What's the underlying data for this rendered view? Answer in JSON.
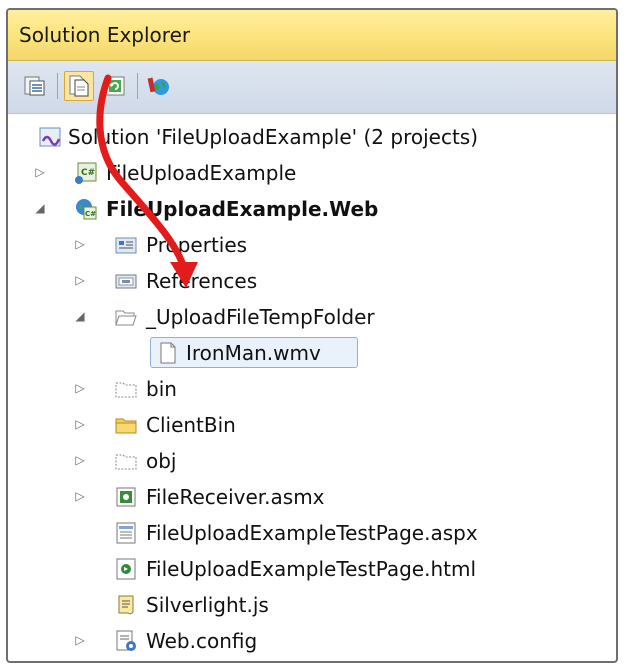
{
  "window": {
    "title": "Solution Explorer"
  },
  "toolbar": {
    "buttons": [
      {
        "icon": "properties-icon"
      },
      {
        "icon": "show-all-files-icon",
        "active": true
      },
      {
        "icon": "refresh-icon"
      },
      {
        "icon": "view-in-browser-icon"
      }
    ]
  },
  "tree": {
    "items": [
      {
        "label": "Solution 'FileUploadExample' (2 projects)",
        "icon": "solution-icon",
        "arrow": ""
      },
      {
        "label": "FileUploadExample",
        "icon": "csharp-project-icon",
        "arrow": "collapsed"
      },
      {
        "label": "FileUploadExample.Web",
        "icon": "web-project-icon",
        "arrow": "expanded",
        "bold": true
      },
      {
        "label": "Properties",
        "icon": "properties-folder-icon",
        "arrow": "collapsed"
      },
      {
        "label": "References",
        "icon": "references-icon",
        "arrow": "collapsed"
      },
      {
        "label": "_UploadFileTempFolder",
        "icon": "open-folder-icon",
        "arrow": "expanded"
      },
      {
        "label": "IronMan.wmv",
        "icon": "file-icon",
        "arrow": "",
        "selected": true
      },
      {
        "label": "bin",
        "icon": "folder-dotted-icon",
        "arrow": "collapsed"
      },
      {
        "label": "ClientBin",
        "icon": "folder-icon",
        "arrow": "collapsed"
      },
      {
        "label": "obj",
        "icon": "folder-dotted-icon",
        "arrow": "collapsed"
      },
      {
        "label": "FileReceiver.asmx",
        "icon": "web-service-icon",
        "arrow": "collapsed"
      },
      {
        "label": "FileUploadExampleTestPage.aspx",
        "icon": "aspx-page-icon",
        "arrow": ""
      },
      {
        "label": "FileUploadExampleTestPage.html",
        "icon": "html-page-icon",
        "arrow": ""
      },
      {
        "label": "Silverlight.js",
        "icon": "script-file-icon",
        "arrow": ""
      },
      {
        "label": "Web.config",
        "icon": "config-file-icon",
        "arrow": "collapsed"
      }
    ]
  },
  "colors": {
    "title_bar": "#fbe27a",
    "toolbar": "#d6dfec",
    "selection_border": "#8fb1d8",
    "annotation_arrow": "#e31b1b"
  }
}
